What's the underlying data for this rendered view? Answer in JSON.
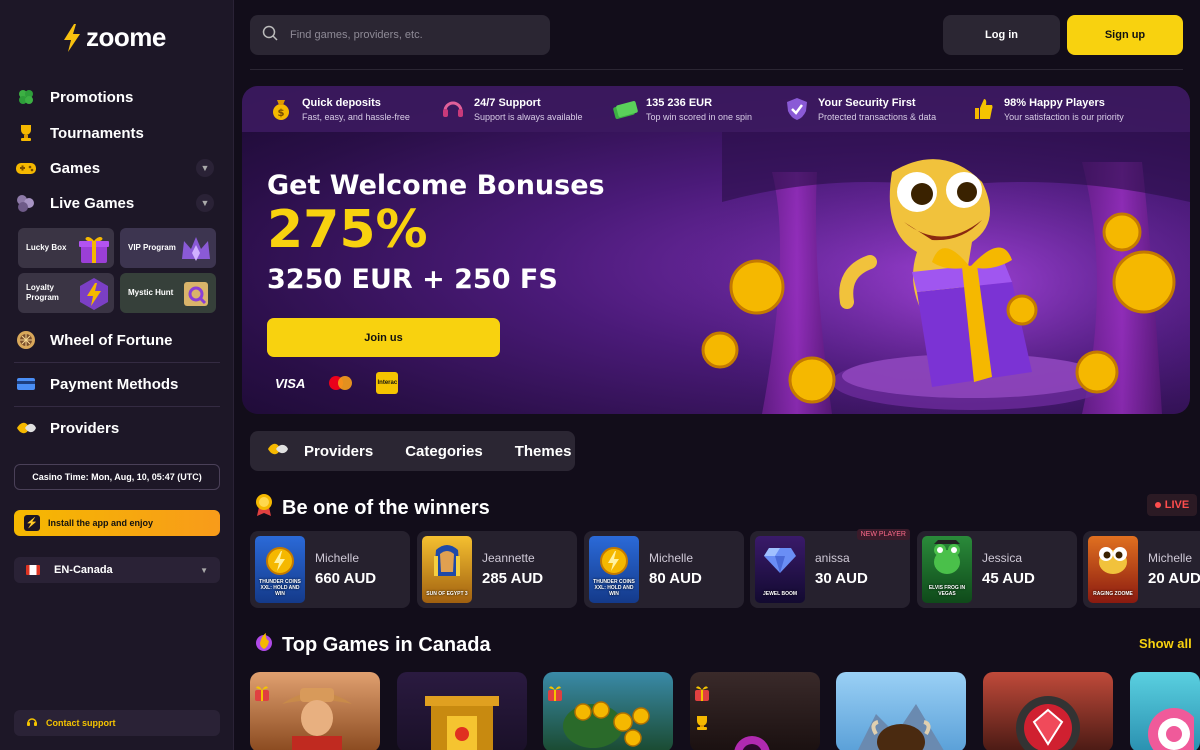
{
  "brand": {
    "logo_text": "zoome"
  },
  "sidebar": {
    "items": [
      {
        "label": "Promotions",
        "icon": "clover-icon"
      },
      {
        "label": "Tournaments",
        "icon": "trophy-icon"
      },
      {
        "label": "Games",
        "icon": "gamepad-icon"
      },
      {
        "label": "Live Games",
        "icon": "cards-icon"
      },
      {
        "label": "Wheel of Fortune",
        "icon": "wheel-icon"
      },
      {
        "label": "Payment Methods",
        "icon": "credit-card-icon"
      },
      {
        "label": "Providers",
        "icon": "providers-icon"
      }
    ],
    "promo_cards": [
      {
        "label": "Lucky Box"
      },
      {
        "label": "VIP Program"
      },
      {
        "label": "Loyalty Program"
      },
      {
        "label": "Mystic Hunt"
      }
    ],
    "casino_time": "Casino Time: Mon, Aug, 10, 05:47 (UTC)",
    "install": "Install the app and enjoy",
    "language": "EN-Canada",
    "support": "Contact support"
  },
  "header": {
    "search_placeholder": "Find games, providers, etc.",
    "login": "Log in",
    "signup": "Sign up"
  },
  "features": [
    {
      "title": "Quick deposits",
      "subtitle": "Fast, easy, and hassle-free"
    },
    {
      "title": "24/7 Support",
      "subtitle": "Support is always available"
    },
    {
      "title": "135 236 EUR",
      "subtitle": "Top win scored in one spin"
    },
    {
      "title": "Your Security First",
      "subtitle": "Protected transactions & data"
    },
    {
      "title": "98% Happy Players",
      "subtitle": "Your satisfaction is our priority"
    }
  ],
  "hero": {
    "line1": "Get Welcome Bonuses",
    "line2": "275%",
    "line3": "3250 EUR + 250 FS",
    "cta": "Join us",
    "payments": {
      "visa": "VISA",
      "interac": "Interac"
    }
  },
  "filters": {
    "providers": "Providers",
    "categories": "Categories",
    "themes": "Themes"
  },
  "winners": {
    "title": "Be one of the winners",
    "live_label": "LIVE",
    "items": [
      {
        "name": "Michelle",
        "amount": "660 AUD",
        "game": "THUNDER COINS XXL: HOLD AND WIN",
        "badge": ""
      },
      {
        "name": "Jeannette",
        "amount": "285 AUD",
        "game": "SUN OF EGYPT 3",
        "badge": ""
      },
      {
        "name": "Michelle",
        "amount": "80 AUD",
        "game": "THUNDER COINS XXL: HOLD AND WIN",
        "badge": ""
      },
      {
        "name": "anissa",
        "amount": "30 AUD",
        "game": "JEWEL BOOM",
        "badge": "NEW PLAYER"
      },
      {
        "name": "Jessica",
        "amount": "45 AUD",
        "game": "ELVIS FROG IN VEGAS",
        "badge": ""
      },
      {
        "name": "Michelle",
        "amount": "20 AUD",
        "game": "RAGING ZOOME",
        "badge": ""
      }
    ]
  },
  "top_games": {
    "title": "Top Games in Canada",
    "show_all": "Show all"
  },
  "colors": {
    "accent": "#f8d20f",
    "live": "#ff4d4d",
    "sidebar": "#1d1727",
    "bg": "#120d1a"
  }
}
